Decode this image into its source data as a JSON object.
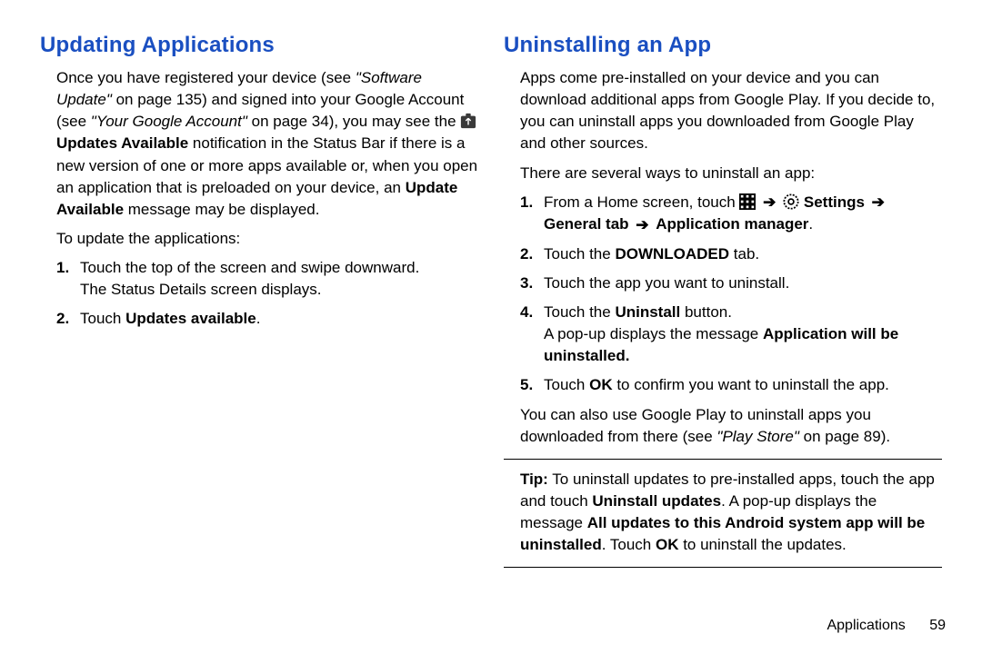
{
  "left": {
    "heading": "Updating Applications",
    "p1_a": "Once you have registered your device (see ",
    "p1_ref1": "\"Software Update\"",
    "p1_b": " on page 135) and signed into your Google Account (see ",
    "p1_ref2": "\"Your Google Account\"",
    "p1_c": " on page 34), you may see the ",
    "p1_updates_avail": "Updates Available",
    "p1_d": " notification in the Status Bar if there is a new version of one or more apps available or, when you open an application that is preloaded on your device, an ",
    "p1_update_avail": "Update Available",
    "p1_e": " message may be displayed.",
    "to_update": "To update the applications:",
    "s1_a": "Touch the top of the screen and swipe downward.",
    "s1_b": "The Status Details screen displays.",
    "s2_a": "Touch ",
    "s2_b": "Updates available",
    "s2_c": "."
  },
  "right": {
    "heading": "Uninstalling an App",
    "p1": "Apps come pre-installed on your device and you can download additional apps from Google Play. If you decide to, you can uninstall apps you downloaded from Google Play and other sources.",
    "p2": "There are several ways to uninstall an app:",
    "s1_a": "From a Home screen, touch ",
    "s1_settings": "Settings",
    "s1_b": "General tab",
    "s1_c": "Application manager",
    "s1_d": ".",
    "s2_a": "Touch the ",
    "s2_b": "DOWNLOADED",
    "s2_c": " tab.",
    "s3": "Touch the app you want to uninstall.",
    "s4_a": "Touch the ",
    "s4_b": "Uninstall",
    "s4_c": " button.",
    "s4_d": "A pop-up displays the message ",
    "s4_e": "Application will be uninstalled.",
    "s5_a": "Touch ",
    "s5_b": "OK",
    "s5_c": " to confirm you want to uninstall the app.",
    "p3_a": "You can also use Google Play to uninstall apps you downloaded from there (see ",
    "p3_ref": "\"Play Store\"",
    "p3_b": " on page 89).",
    "tip_label": "Tip:",
    "tip_a": " To uninstall updates to pre-installed apps, touch the app and touch ",
    "tip_b": "Uninstall updates",
    "tip_c": ". A pop-up displays the message ",
    "tip_d": "All updates to this Android system app will be uninstalled",
    "tip_e": ". Touch ",
    "tip_f": "OK",
    "tip_g": " to uninstall the updates."
  },
  "footer": {
    "section": "Applications",
    "page": "59"
  },
  "nums": {
    "n1": "1.",
    "n2": "2.",
    "n3": "3.",
    "n4": "4.",
    "n5": "5."
  }
}
